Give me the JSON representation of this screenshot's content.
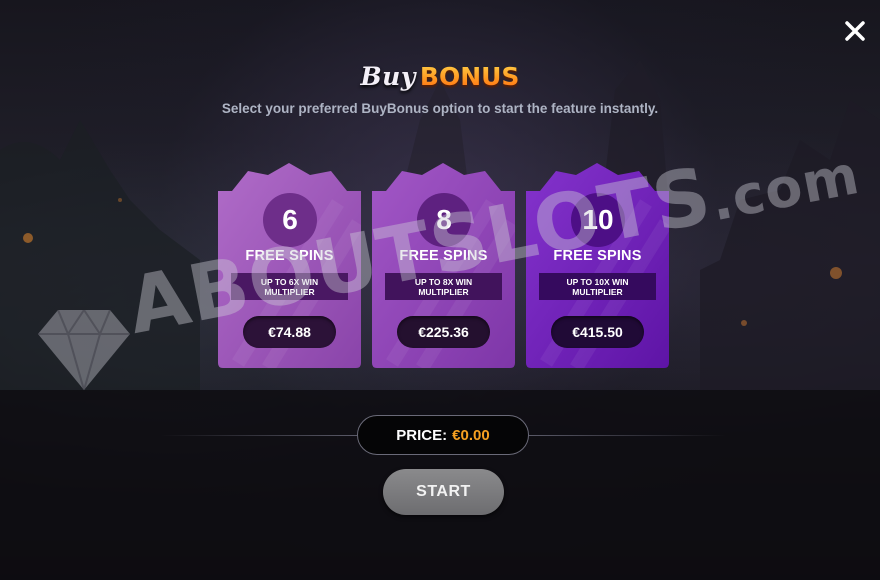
{
  "header": {
    "title_part1": "Buy",
    "title_part2": "BONUS",
    "subtitle": "Select your preferred BuyBonus option to start the feature instantly."
  },
  "options": [
    {
      "spins": "6",
      "label": "FREE SPINS",
      "multiplier_line1": "UP TO 6X WIN",
      "multiplier_line2": "MULTIPLIER",
      "price": "€74.88"
    },
    {
      "spins": "8",
      "label": "FREE SPINS",
      "multiplier_line1": "UP TO 8X WIN",
      "multiplier_line2": "MULTIPLIER",
      "price": "€225.36"
    },
    {
      "spins": "10",
      "label": "FREE SPINS",
      "multiplier_line1": "UP TO 10X WIN",
      "multiplier_line2": "MULTIPLIER",
      "price": "€415.50"
    }
  ],
  "footer": {
    "price_label": "PRICE:",
    "price_value": "€0.00",
    "start_label": "START"
  },
  "watermark": {
    "text": "ABOUTSLOTS",
    "domain": ".com"
  },
  "colors": {
    "card1": "#9a52b8",
    "card2": "#8a3fb0",
    "card3": "#6f22b6",
    "accent_orange": "#f6a021"
  },
  "icons": {
    "close": "close-icon",
    "watermark_logo": "diamond-icon"
  }
}
